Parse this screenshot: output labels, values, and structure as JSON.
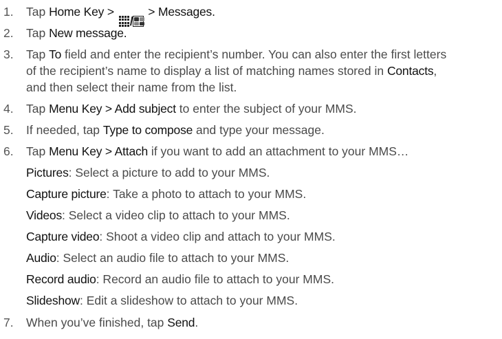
{
  "steps": [
    {
      "num": "1.",
      "pre": "Tap ",
      "b1": "Home Key >",
      "post": " > Messages."
    },
    {
      "num": "2.",
      "pre": "Tap ",
      "b1": "New message."
    },
    {
      "num": "3.",
      "pre": "Tap ",
      "b1": "To",
      "mid": " field and enter the recipient’s number. You can also enter the first letters",
      "line2_pre": "of the recipient’s name to display a list of matching names stored in ",
      "line2_b": "Contacts",
      "line2_post": ",",
      "line3": "and then select their name from the list."
    },
    {
      "num": "4.",
      "pre": "Tap ",
      "b1": "Menu Key > Add subject",
      "post": " to enter the subject of your MMS."
    },
    {
      "num": "5.",
      "pre": "If needed, tap ",
      "b1": "Type to compose",
      "post": " and type your message."
    },
    {
      "num": "6.",
      "pre": "Tap ",
      "b1": "Menu Key > Attach",
      "post": " if you want to add an attachment to your MMS…"
    },
    {
      "num": "7.",
      "pre": "When you’ve finished, tap ",
      "b1": "Send",
      "post": "."
    }
  ],
  "attach_options": [
    {
      "label": "Pictures",
      "desc": ": Select a picture to add to your MMS."
    },
    {
      "label": "Capture picture",
      "desc": ": Take a photo to attach to your MMS."
    },
    {
      "label": "Videos",
      "desc": ": Select a video clip to attach to your MMS."
    },
    {
      "label": "Capture video",
      "desc": ": Shoot a video clip and attach to your MMS."
    },
    {
      "label": "Audio",
      "desc": ": Select an audio file to attach to your MMS."
    },
    {
      "label": "Record audio",
      "desc": ": Record an audio file to attach to your MMS."
    },
    {
      "label": "Slideshow",
      "desc": ": Edit a slideshow to attach to your MMS."
    }
  ],
  "icons": {
    "grid": "grid-apps-icon",
    "separator": "/",
    "tiles": "tiles-apps-icon"
  }
}
